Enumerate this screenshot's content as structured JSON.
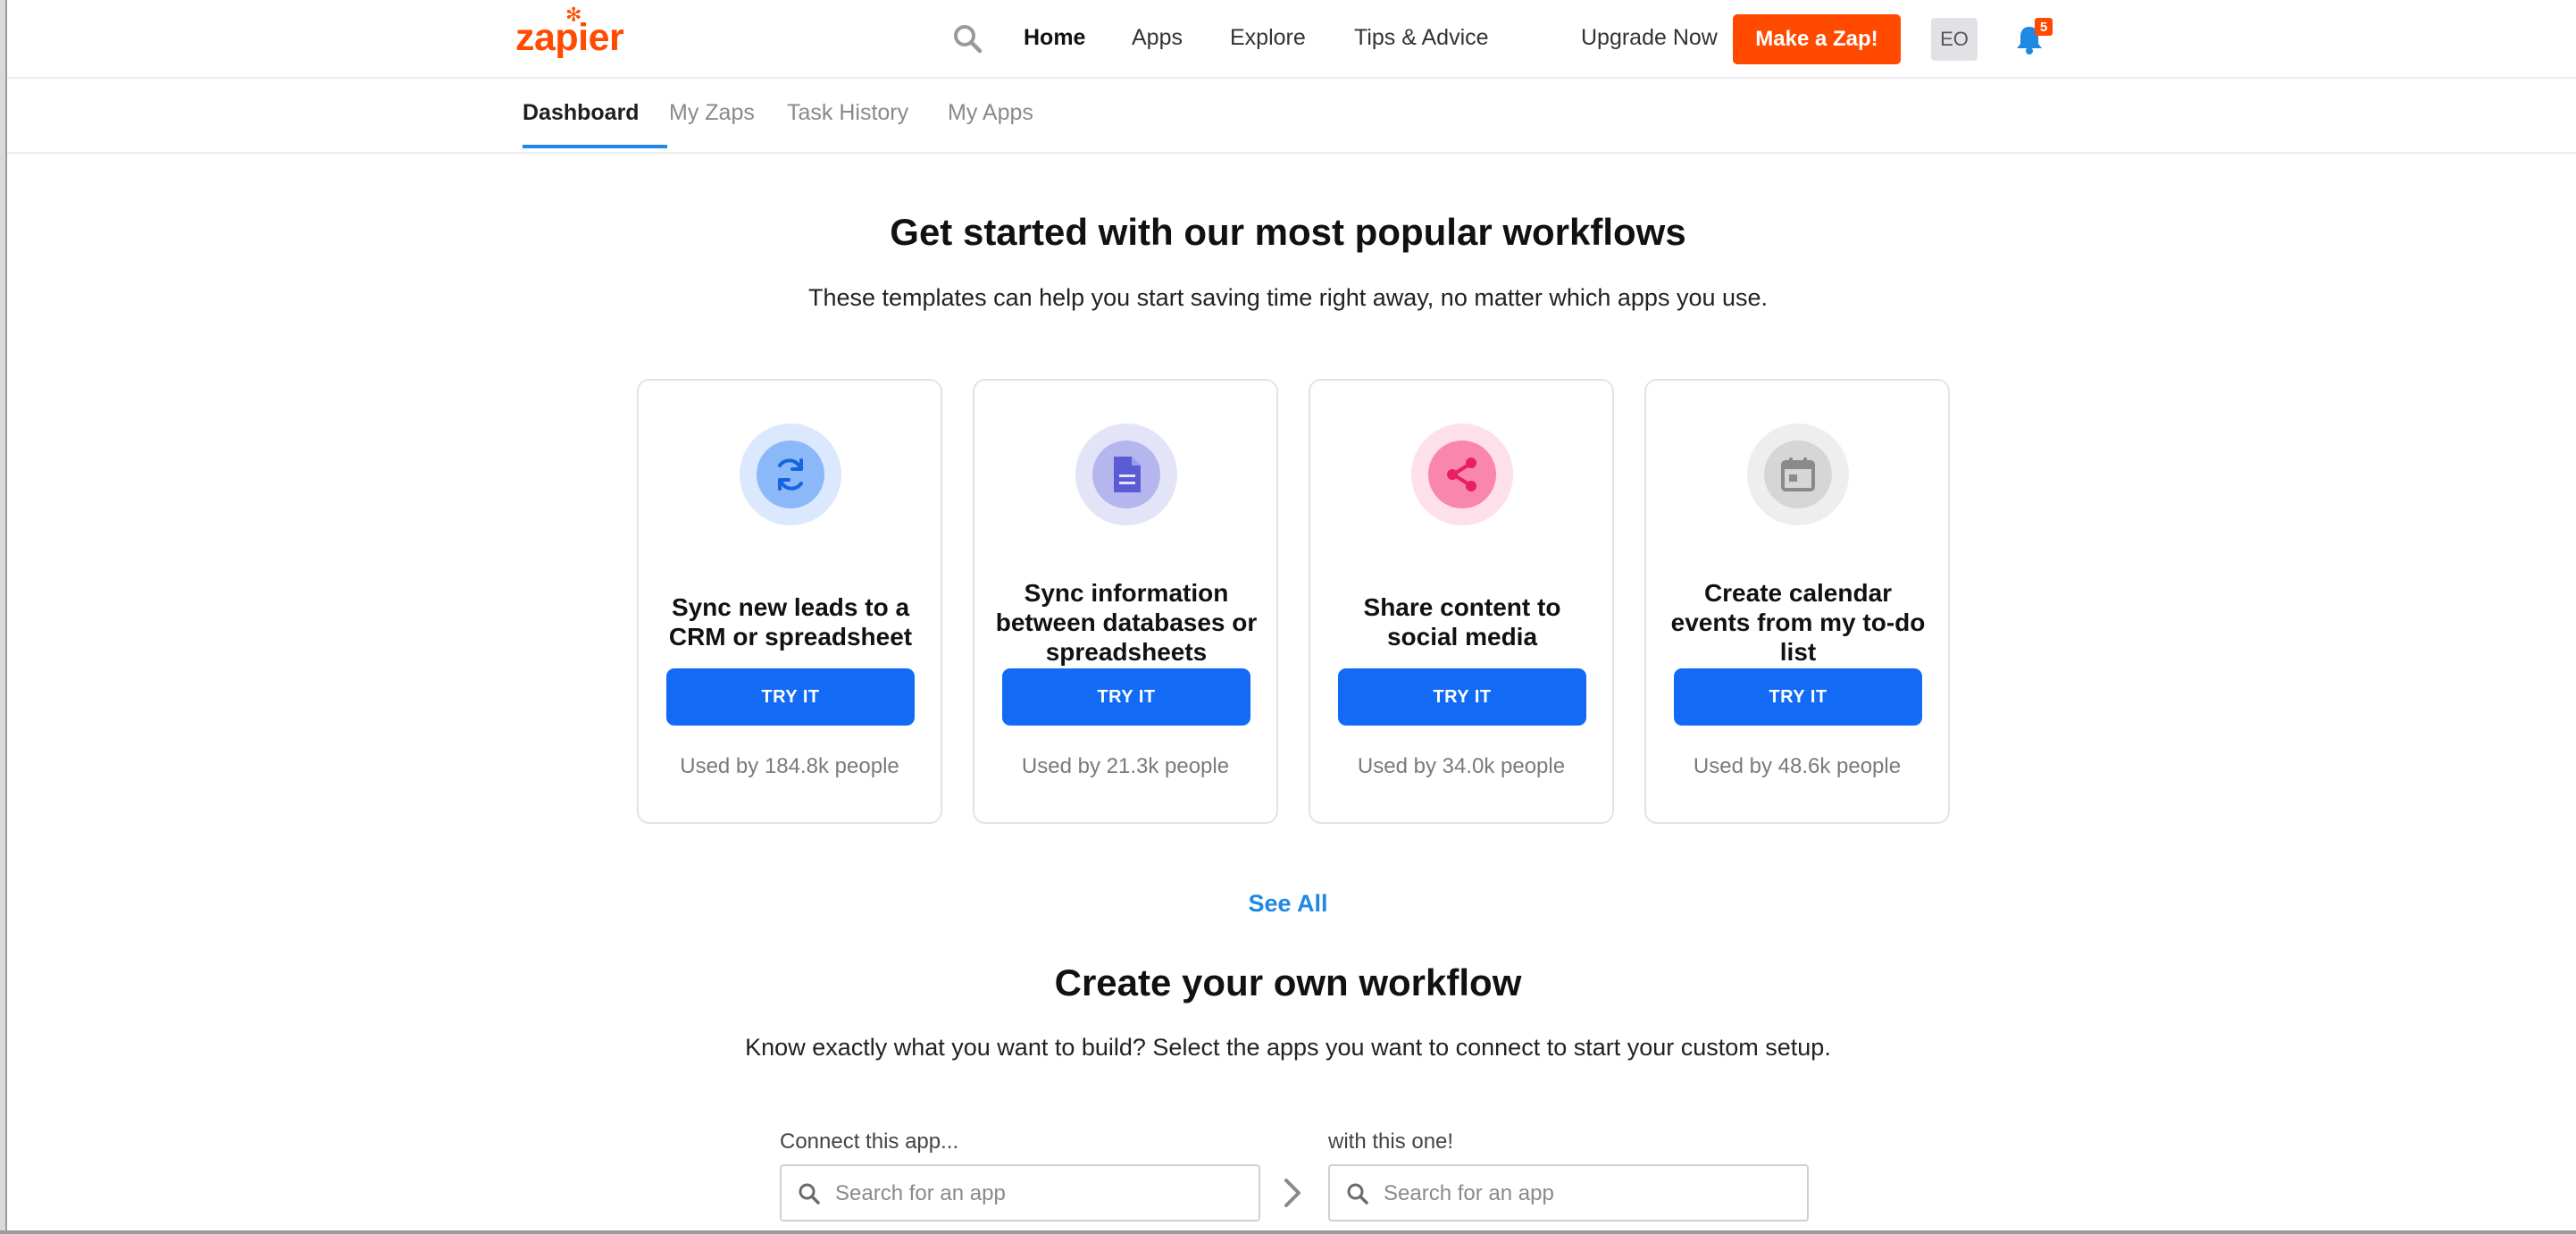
{
  "header": {
    "logo_text": "zapier",
    "logo_star": "✻",
    "nav": [
      {
        "label": "Home",
        "active": true
      },
      {
        "label": "Apps"
      },
      {
        "label": "Explore"
      },
      {
        "label": "Tips & Advice"
      }
    ],
    "upgrade_label": "Upgrade Now",
    "make_zap_label": "Make a Zap!",
    "avatar_initials": "EO",
    "notification_count": "5"
  },
  "subnav": {
    "tabs": [
      {
        "label": "Dashboard",
        "active": true
      },
      {
        "label": "My Zaps"
      },
      {
        "label": "Task History"
      },
      {
        "label": "My Apps"
      }
    ]
  },
  "popular": {
    "title": "Get started with our most popular workflows",
    "subtitle": "These templates can help you start saving time right away, no matter which apps you use.",
    "cards": [
      {
        "icon": "sync-icon",
        "title": "Sync new leads to a CRM or spreadsheet",
        "button": "TRY IT",
        "usage": "Used by 184.8k people",
        "outer_color": "#dbe8fd",
        "inner_color": "#8ab8f8",
        "icon_color": "#1565e0"
      },
      {
        "icon": "document-icon",
        "title": "Sync information between databases or spreadsheets",
        "button": "TRY IT",
        "usage": "Used by 21.3k people",
        "outer_color": "#e4e4f8",
        "inner_color": "#b6b6ee",
        "icon_color": "#5b5bd6"
      },
      {
        "icon": "share-icon",
        "title": "Share content to social media",
        "button": "TRY IT",
        "usage": "Used by 34.0k people",
        "outer_color": "#fde0ea",
        "inner_color": "#f886ad",
        "icon_color": "#e91e63"
      },
      {
        "icon": "calendar-icon",
        "title": "Create calendar events from my to-do list",
        "button": "TRY IT",
        "usage": "Used by 48.6k people",
        "outer_color": "#eeeeee",
        "inner_color": "#d6d6d6",
        "icon_color": "#8a8a8a"
      }
    ],
    "see_all_label": "See All"
  },
  "custom": {
    "title": "Create your own workflow",
    "subtitle": "Know exactly what you want to build? Select the apps you want to connect to start your custom setup.",
    "connect_label": "Connect this app...",
    "with_label": "with this one!",
    "search_placeholder": "Search for an app"
  }
}
